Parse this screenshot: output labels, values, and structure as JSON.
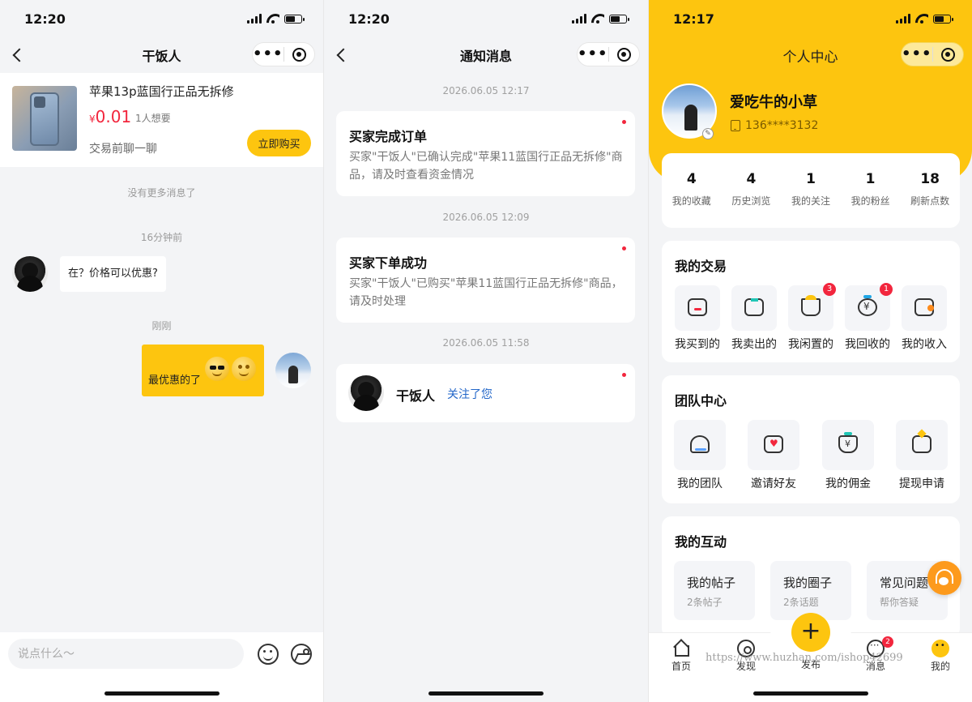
{
  "chat": {
    "time": "12:20",
    "title": "干饭人",
    "product": {
      "title": "苹果13p蓝国行正品无拆修",
      "currency": "¥",
      "price": "0.01",
      "wants": "1人想要",
      "chat_hint": "交易前聊一聊",
      "buy_label": "立即购买"
    },
    "no_more": "没有更多消息了",
    "time_1": "16分钟前",
    "msg_1": "在？价格可以优惠?",
    "time_2": "刚刚",
    "msg_2": "最优惠的了",
    "input_placeholder": "说点什么～"
  },
  "notifications": {
    "time": "12:20",
    "title": "通知消息",
    "items": [
      {
        "timestamp": "2026.06.05 12:17",
        "title": "买家完成订单",
        "body": "买家\"干饭人\"已确认完成\"苹果11蓝国行正品无拆修\"商品，请及时查看资金情况"
      },
      {
        "timestamp": "2026.06.05 12:09",
        "title": "买家下单成功",
        "body": "买家\"干饭人\"已购买\"苹果11蓝国行正品无拆修\"商品，请及时处理"
      },
      {
        "timestamp": "2026.06.05 11:58",
        "name": "干饭人",
        "action": "关注了您"
      }
    ]
  },
  "profile": {
    "time": "12:17",
    "title": "个人中心",
    "nickname": "爱吃牛的小草",
    "phone": "136****3132",
    "stats": [
      {
        "num": "4",
        "label": "我的收藏"
      },
      {
        "num": "4",
        "label": "历史浏览"
      },
      {
        "num": "1",
        "label": "我的关注"
      },
      {
        "num": "1",
        "label": "我的粉丝"
      },
      {
        "num": "18",
        "label": "刷新点数"
      }
    ],
    "trade": {
      "title": "我的交易",
      "items": [
        {
          "label": "我买到的"
        },
        {
          "label": "我卖出的"
        },
        {
          "label": "我闲置的",
          "badge": "3"
        },
        {
          "label": "我回收的",
          "badge": "1"
        },
        {
          "label": "我的收入"
        }
      ]
    },
    "team": {
      "title": "团队中心",
      "items": [
        {
          "label": "我的团队"
        },
        {
          "label": "邀请好友"
        },
        {
          "label": "我的佣金"
        },
        {
          "label": "提现申请"
        }
      ]
    },
    "interact": {
      "title": "我的互动",
      "items": [
        {
          "title": "我的帖子",
          "sub": "2条帖子"
        },
        {
          "title": "我的圈子",
          "sub": "2条话题"
        },
        {
          "title": "常见问题",
          "sub": "帮你答疑"
        }
      ]
    },
    "tabs": [
      {
        "label": "首页"
      },
      {
        "label": "发现"
      },
      {
        "label": "发布"
      },
      {
        "label": "消息",
        "badge": "2"
      },
      {
        "label": "我的"
      }
    ],
    "watermark": "https://www.huzhan.com/ishop42699"
  },
  "colors": {
    "accent": "#fdc50f",
    "price_red": "#f2263d",
    "link_blue": "#2367c9"
  }
}
